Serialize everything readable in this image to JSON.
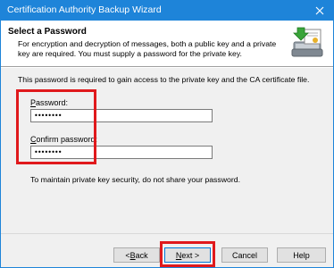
{
  "window": {
    "title": "Certification Authority Backup Wizard",
    "close_glyph": "✕"
  },
  "header": {
    "heading": "Select a Password",
    "description": "For encryption and decryption of messages, both a public key and a private key are required. You must supply a password for the private key.",
    "icon": "certificate-backup-icon"
  },
  "content": {
    "info": "This password is required to gain access to the private key and the CA certificate file.",
    "password_label_accel": "P",
    "password_label_rest": "assword:",
    "password_value": "••••••••",
    "confirm_label_accel": "C",
    "confirm_label_rest": "onfirm password:",
    "confirm_value": "••••••••",
    "tip": "To maintain private key security, do not share your password."
  },
  "buttons": {
    "back_prefix": "< ",
    "back_accel": "B",
    "back_rest": "ack",
    "next_accel": "N",
    "next_rest": "ext >",
    "cancel": "Cancel",
    "help": "Help"
  },
  "colors": {
    "titlebar": "#1e84d9",
    "highlight": "#e0191c"
  }
}
